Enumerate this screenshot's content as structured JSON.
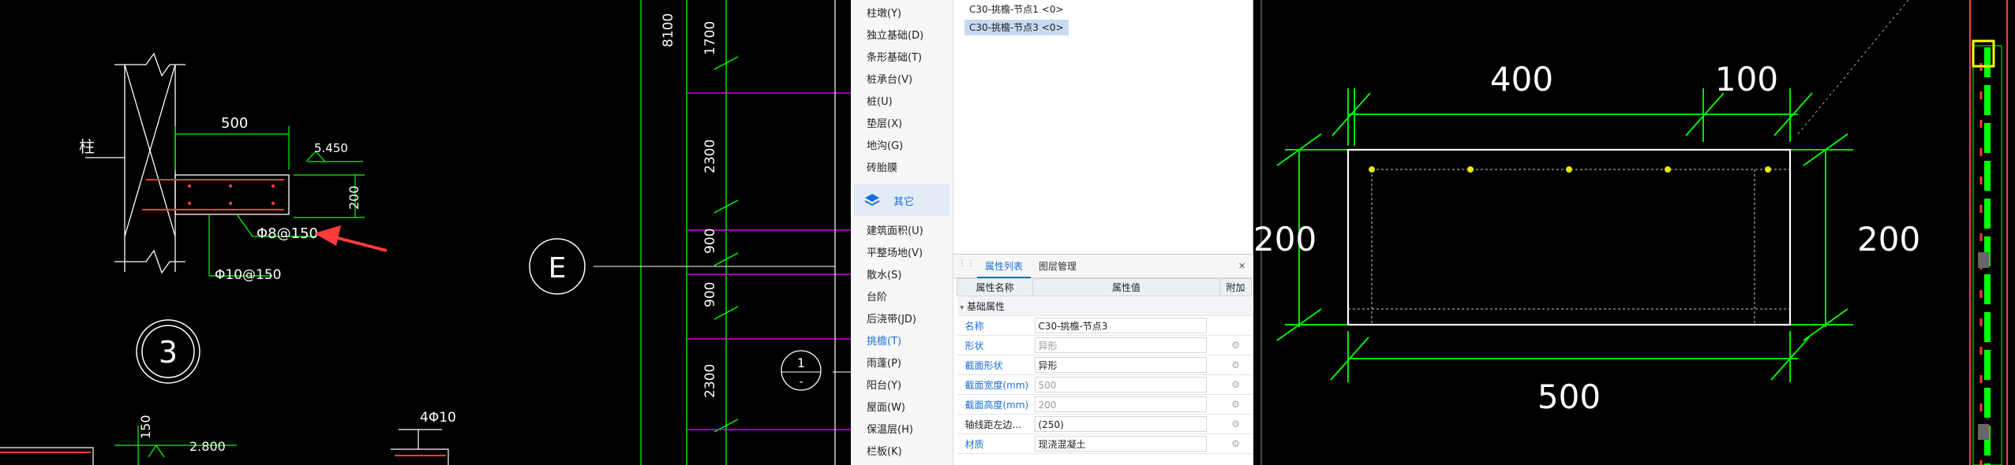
{
  "left_drawing": {
    "detail_labels": {
      "column": "柱",
      "dim_width": "500",
      "elevation_top": "5.450",
      "dim_height": "200",
      "rebar_main": "Φ8@150",
      "rebar_dist": "Φ10@150",
      "section_no": "3",
      "dim_bottom": "150",
      "elevation_bottom": "2.800",
      "rebar_count": "4Φ10"
    },
    "axis_dims": [
      "8100",
      "1700",
      "2300",
      "900",
      "900",
      "2300"
    ],
    "axis_label": "E",
    "section_marker": {
      "top": "1",
      "bottom": "-"
    }
  },
  "nav": {
    "items_top": [
      {
        "label": "柱墩(Y)"
      },
      {
        "label": "独立基础(D)"
      },
      {
        "label": "条形基础(T)"
      },
      {
        "label": "桩承台(V)"
      },
      {
        "label": "桩(U)"
      },
      {
        "label": "垫层(X)"
      },
      {
        "label": "地沟(G)"
      },
      {
        "label": "砖胎膜"
      }
    ],
    "group_label": "其它",
    "items_bottom": [
      {
        "label": "建筑面积(U)"
      },
      {
        "label": "平整场地(V)"
      },
      {
        "label": "散水(S)"
      },
      {
        "label": "台阶"
      },
      {
        "label": "后浇带(JD)"
      },
      {
        "label": "挑檐(T)"
      },
      {
        "label": "雨蓬(P)"
      },
      {
        "label": "阳台(Y)"
      },
      {
        "label": "屋面(W)"
      },
      {
        "label": "保温层(H)"
      },
      {
        "label": "栏板(K)"
      }
    ]
  },
  "tree": {
    "items": [
      "C30-挑檐-节点1 <0>",
      "C30-挑檐-节点3 <0>"
    ]
  },
  "properties": {
    "tabs": [
      "属性列表",
      "图层管理"
    ],
    "columns": [
      "属性名称",
      "属性值",
      "附加"
    ],
    "section": "基础属性",
    "rows": [
      {
        "name": "名称",
        "value": "C30-挑檐-节点3",
        "dim": false
      },
      {
        "name": "形状",
        "value": "异形",
        "dim": true
      },
      {
        "name": "截面形状",
        "value": "异形",
        "dim": false
      },
      {
        "name": "截面宽度(mm)",
        "value": "500",
        "dim": true
      },
      {
        "name": "截面高度(mm)",
        "value": "200",
        "dim": true
      },
      {
        "name": "轴线距左边...",
        "value": "(250)",
        "dim": false
      },
      {
        "name": "材质",
        "value": "现浇混凝土",
        "dim": false
      }
    ]
  },
  "right_drawing": {
    "dim_top_left": "400",
    "dim_top_right": "100",
    "dim_left": "200",
    "dim_right": "200",
    "dim_bottom": "500"
  },
  "colors": {
    "cad_background": "#000000",
    "dim_green": "#00ff00",
    "accent_blue": "#1a6fd8",
    "rebar_red": "#ff3b3b",
    "axis_magenta": "#ff00ff"
  }
}
